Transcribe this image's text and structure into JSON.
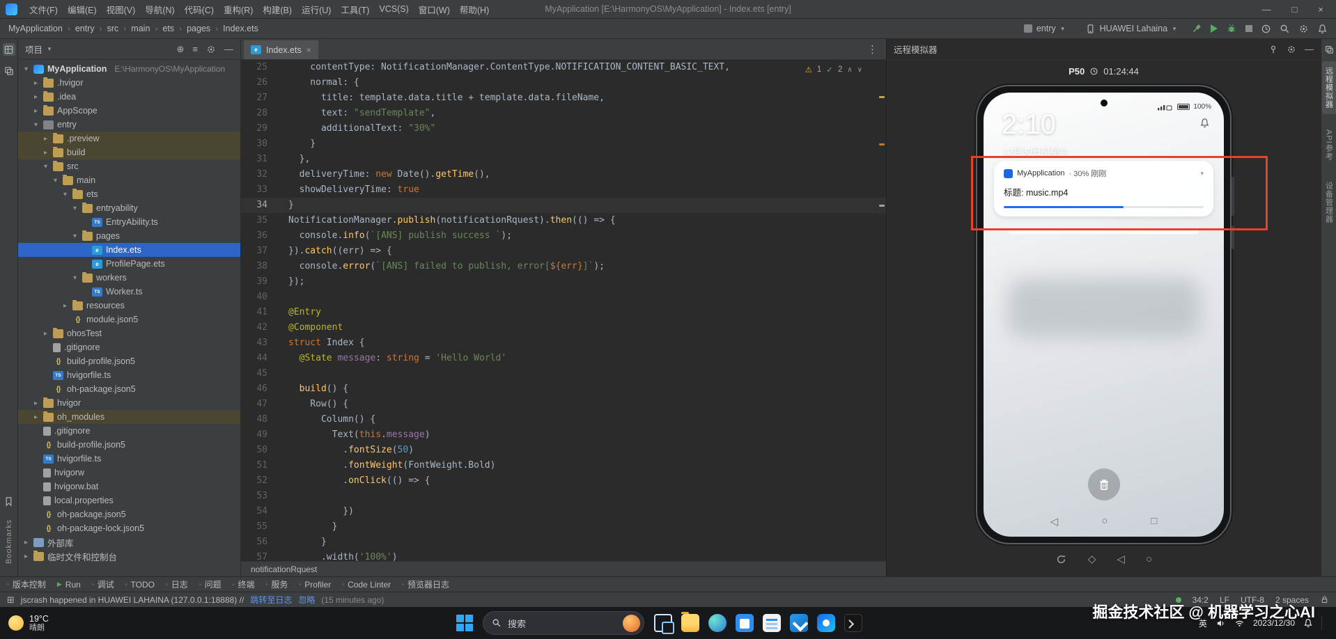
{
  "icons": {
    "caret_down": "▼",
    "close": "×",
    "maximize": "□",
    "minimize": "—",
    "more_vertical": "⋮",
    "warning": "⚠",
    "check": "✓",
    "chevron_up": "∧",
    "chevron_down": "∨",
    "crumb_separator": "›",
    "locate": "⊕",
    "collapse": "≡",
    "tool_grid": "⊞",
    "run": "▶",
    "bullet": "▫",
    "tree_expanded": "▾",
    "tree_collapsed": "▸",
    "expand_arrow": "▾",
    "nav_back": "◁",
    "nav_home": "○",
    "nav_recent": "□",
    "diamond": "◇"
  },
  "titlebar": {
    "menus": [
      "文件(F)",
      "编辑(E)",
      "视图(V)",
      "导航(N)",
      "代码(C)",
      "重构(R)",
      "构建(B)",
      "运行(U)",
      "工具(T)",
      "VCS(S)",
      "窗口(W)",
      "帮助(H)"
    ],
    "title": "MyApplication [E:\\HarmonyOS\\MyApplication] - Index.ets [entry]"
  },
  "navbar": {
    "breadcrumbs": [
      "MyApplication",
      "entry",
      "src",
      "main",
      "ets",
      "pages",
      "Index.ets"
    ],
    "run_config": "entry",
    "device": "HUAWEI Lahaina"
  },
  "project_panel": {
    "title": "项目",
    "tree": [
      {
        "label": "MyApplication",
        "hint": "E:\\HarmonyOS\\MyApplication",
        "indent": 0,
        "icon": "project",
        "arrow": "down",
        "bold": true
      },
      {
        "label": ".hvigor",
        "indent": 1,
        "icon": "folder",
        "arrow": "right"
      },
      {
        "label": ".idea",
        "indent": 1,
        "icon": "folder",
        "arrow": "right"
      },
      {
        "label": "AppScope",
        "indent": 1,
        "icon": "folder",
        "arrow": "right"
      },
      {
        "label": "entry",
        "indent": 1,
        "icon": "module",
        "arrow": "down"
      },
      {
        "label": ".preview",
        "indent": 2,
        "icon": "folder",
        "arrow": "right",
        "row": "excluded"
      },
      {
        "label": "build",
        "indent": 2,
        "icon": "folder",
        "arrow": "right",
        "row": "excluded"
      },
      {
        "label": "src",
        "indent": 2,
        "icon": "folder",
        "arrow": "down"
      },
      {
        "label": "main",
        "indent": 3,
        "icon": "folder",
        "arrow": "down"
      },
      {
        "label": "ets",
        "indent": 4,
        "icon": "folder",
        "arrow": "down"
      },
      {
        "label": "entryability",
        "indent": 5,
        "icon": "folder",
        "arrow": "down"
      },
      {
        "label": "EntryAbility.ts",
        "indent": 6,
        "icon": "ts",
        "arrow": "none"
      },
      {
        "label": "pages",
        "indent": 5,
        "icon": "folder",
        "arrow": "down"
      },
      {
        "label": "Index.ets",
        "indent": 6,
        "icon": "ets",
        "arrow": "none",
        "row": "selected"
      },
      {
        "label": "ProfilePage.ets",
        "indent": 6,
        "icon": "ets",
        "arrow": "none"
      },
      {
        "label": "workers",
        "indent": 5,
        "icon": "folder",
        "arrow": "down"
      },
      {
        "label": "Worker.ts",
        "indent": 6,
        "icon": "ts",
        "arrow": "none"
      },
      {
        "label": "resources",
        "indent": 4,
        "icon": "folder",
        "arrow": "right"
      },
      {
        "label": "module.json5",
        "indent": 4,
        "icon": "json",
        "arrow": "none"
      },
      {
        "label": "ohosTest",
        "indent": 2,
        "icon": "folder",
        "arrow": "right"
      },
      {
        "label": ".gitignore",
        "indent": 2,
        "icon": "file",
        "arrow": "none"
      },
      {
        "label": "build-profile.json5",
        "indent": 2,
        "icon": "json",
        "arrow": "none"
      },
      {
        "label": "hvigorfile.ts",
        "indent": 2,
        "icon": "ts",
        "arrow": "none"
      },
      {
        "label": "oh-package.json5",
        "indent": 2,
        "icon": "json",
        "arrow": "none"
      },
      {
        "label": "hvigor",
        "indent": 1,
        "icon": "folder",
        "arrow": "right"
      },
      {
        "label": "oh_modules",
        "indent": 1,
        "icon": "folder",
        "arrow": "right",
        "row": "excluded"
      },
      {
        "label": ".gitignore",
        "indent": 1,
        "icon": "file",
        "arrow": "none"
      },
      {
        "label": "build-profile.json5",
        "indent": 1,
        "icon": "json",
        "arrow": "none"
      },
      {
        "label": "hvigorfile.ts",
        "indent": 1,
        "icon": "ts",
        "arrow": "none"
      },
      {
        "label": "hvigorw",
        "indent": 1,
        "icon": "file",
        "arrow": "none"
      },
      {
        "label": "hvigorw.bat",
        "indent": 1,
        "icon": "file",
        "arrow": "none"
      },
      {
        "label": "local.properties",
        "indent": 1,
        "icon": "file",
        "arrow": "none"
      },
      {
        "label": "oh-package.json5",
        "indent": 1,
        "icon": "json",
        "arrow": "none"
      },
      {
        "label": "oh-package-lock.json5",
        "indent": 1,
        "icon": "json",
        "arrow": "none"
      },
      {
        "label": "外部库",
        "indent": 0,
        "icon": "lib",
        "arrow": "right"
      },
      {
        "label": "临时文件和控制台",
        "indent": 0,
        "icon": "scratch",
        "arrow": "right"
      }
    ]
  },
  "editor": {
    "tab": "Index.ets",
    "warnings": "1",
    "passed": "2",
    "breadcrumb": "notificationRquest",
    "lines": [
      {
        "n": 25,
        "seg": [
          [
            "p",
            "    contentType: NotificationManager.ContentType.NOTIFICATION_CONTENT_BASIC_TEXT,"
          ]
        ]
      },
      {
        "n": 26,
        "seg": [
          [
            "p",
            "    normal: {"
          ]
        ]
      },
      {
        "n": 27,
        "seg": [
          [
            "p",
            "      title: template.data.title + template.data.fileName,"
          ]
        ]
      },
      {
        "n": 28,
        "seg": [
          [
            "p",
            "      text: "
          ],
          [
            "s",
            "\"sendTemplate\""
          ],
          [
            "p",
            ","
          ]
        ]
      },
      {
        "n": 29,
        "seg": [
          [
            "p",
            "      additionalText: "
          ],
          [
            "s",
            "\"30%\""
          ]
        ]
      },
      {
        "n": 30,
        "seg": [
          [
            "p",
            "    }"
          ]
        ]
      },
      {
        "n": 31,
        "seg": [
          [
            "p",
            "  },"
          ]
        ]
      },
      {
        "n": 32,
        "seg": [
          [
            "p",
            "  deliveryTime: "
          ],
          [
            "k",
            "new"
          ],
          [
            "p",
            " Date()."
          ],
          [
            "f",
            "getTime"
          ],
          [
            "p",
            "(),"
          ]
        ]
      },
      {
        "n": 33,
        "seg": [
          [
            "p",
            "  showDeliveryTime: "
          ],
          [
            "k",
            "true"
          ]
        ]
      },
      {
        "n": 34,
        "seg": [
          [
            "p",
            "}"
          ]
        ],
        "active": true
      },
      {
        "n": 35,
        "seg": [
          [
            "p",
            "NotificationManager."
          ],
          [
            "f",
            "publish"
          ],
          [
            "p",
            "(notificationRquest)."
          ],
          [
            "f",
            "then"
          ],
          [
            "p",
            "(() => {"
          ]
        ]
      },
      {
        "n": 36,
        "seg": [
          [
            "p",
            "  console."
          ],
          [
            "f",
            "info"
          ],
          [
            "p",
            "("
          ],
          [
            "s",
            "`[ANS] publish success `"
          ],
          [
            "p",
            ");"
          ]
        ]
      },
      {
        "n": 37,
        "seg": [
          [
            "p",
            "})."
          ],
          [
            "f",
            "catch"
          ],
          [
            "p",
            "((err) => {"
          ]
        ]
      },
      {
        "n": 38,
        "seg": [
          [
            "p",
            "  console."
          ],
          [
            "f",
            "error"
          ],
          [
            "p",
            "("
          ],
          [
            "s",
            "`[ANS] failed to publish, error["
          ],
          [
            "k",
            "${err}"
          ],
          [
            "s",
            "]`"
          ],
          [
            "p",
            ");"
          ]
        ]
      },
      {
        "n": 39,
        "seg": [
          [
            "p",
            "});"
          ]
        ]
      },
      {
        "n": 40,
        "seg": []
      },
      {
        "n": 41,
        "seg": [
          [
            "d",
            "@Entry"
          ]
        ]
      },
      {
        "n": 42,
        "seg": [
          [
            "d",
            "@Component"
          ]
        ]
      },
      {
        "n": 43,
        "seg": [
          [
            "k",
            "struct"
          ],
          [
            "p",
            " Index {"
          ]
        ]
      },
      {
        "n": 44,
        "seg": [
          [
            "p",
            "  "
          ],
          [
            "d",
            "@State"
          ],
          [
            "p",
            " "
          ],
          [
            "m",
            "message"
          ],
          [
            "p",
            ": "
          ],
          [
            "k",
            "string"
          ],
          [
            "p",
            " = "
          ],
          [
            "s",
            "'Hello World'"
          ]
        ]
      },
      {
        "n": 45,
        "seg": []
      },
      {
        "n": 46,
        "seg": [
          [
            "p",
            "  "
          ],
          [
            "f",
            "build"
          ],
          [
            "p",
            "() {"
          ]
        ]
      },
      {
        "n": 47,
        "seg": [
          [
            "p",
            "    Row() {"
          ]
        ]
      },
      {
        "n": 48,
        "seg": [
          [
            "p",
            "      Column() {"
          ]
        ]
      },
      {
        "n": 49,
        "seg": [
          [
            "p",
            "        Text("
          ],
          [
            "k",
            "this"
          ],
          [
            "p",
            "."
          ],
          [
            "m",
            "message"
          ],
          [
            "p",
            ")"
          ]
        ]
      },
      {
        "n": 50,
        "seg": [
          [
            "p",
            "          ."
          ],
          [
            "f",
            "fontSize"
          ],
          [
            "p",
            "("
          ],
          [
            "n",
            "50"
          ],
          [
            "p",
            ")"
          ]
        ]
      },
      {
        "n": 51,
        "seg": [
          [
            "p",
            "          ."
          ],
          [
            "f",
            "fontWeight"
          ],
          [
            "p",
            "(FontWeight.Bold)"
          ]
        ]
      },
      {
        "n": 52,
        "seg": [
          [
            "p",
            "          ."
          ],
          [
            "f",
            "onClick"
          ],
          [
            "p",
            "(() => {"
          ]
        ]
      },
      {
        "n": 53,
        "seg": []
      },
      {
        "n": 54,
        "seg": [
          [
            "p",
            "          })"
          ]
        ]
      },
      {
        "n": 55,
        "seg": [
          [
            "p",
            "        }"
          ]
        ]
      },
      {
        "n": 56,
        "seg": [
          [
            "p",
            "      }"
          ]
        ]
      },
      {
        "n": 57,
        "seg": [
          [
            "p",
            "      .width("
          ],
          [
            "s",
            "'100%'"
          ],
          [
            "p",
            ")"
          ]
        ]
      }
    ]
  },
  "emulator": {
    "title": "远程模拟器",
    "device": "P50",
    "timer": "01:24:44",
    "screen": {
      "battery": "100%",
      "clock": "2:10",
      "date": "12月30日星期六",
      "notification": {
        "app": "MyApplication",
        "meta": "· 30% 刚刚",
        "body": "标题: music.mp4",
        "progress_percent": 60
      }
    }
  },
  "toolwindows": {
    "items": [
      "版本控制",
      "Run",
      "调试",
      "TODO",
      "日志",
      "问题",
      "终端",
      "服务",
      "Profiler",
      "Code Linter",
      "预览器日志"
    ]
  },
  "statusbar": {
    "message": "jscrash happened in HUAWEI LAHAINA (127.0.0.1:18888) //",
    "link_log": "跳转至日志",
    "link_ignore": "忽略",
    "ago": "(15 minutes ago)",
    "caret": "34:2",
    "line_sep": "LF",
    "encoding": "UTF-8",
    "indent": "2 spaces"
  },
  "taskbar": {
    "temp": "19°C",
    "weather": "晴朗",
    "search_placeholder": "搜索",
    "apps": [
      "task-view",
      "file-explorer",
      "edge",
      "store",
      "docs",
      "vscode",
      "deveco",
      "terminal"
    ],
    "ime": "英",
    "date": "2023/12/30"
  },
  "strips": {
    "left_bottom": "Bookmarks",
    "right_items": [
      "远程模拟器",
      "API参考",
      "设备管理器"
    ]
  },
  "watermark": "掘金技术社区 @ 机器学习之心AI"
}
